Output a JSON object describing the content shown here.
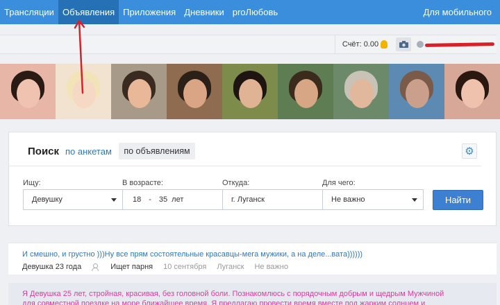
{
  "nav": {
    "items": [
      "Трансляции",
      "Объявления",
      "Приложения",
      "Дневники",
      "proЛюбовь"
    ],
    "active_index": 1,
    "mobile_label": "Для мобильного"
  },
  "user_bar": {
    "score_label": "Счёт: 0.00",
    "camera_icon": "camera-icon",
    "hand_icon": "hand-coin-icon"
  },
  "photos": {
    "count": 9,
    "tones": [
      "#e7b6a6",
      "#f1e3d0",
      "#a89a88",
      "#8f6b4f",
      "#7d8c4a",
      "#5f7d52",
      "#6c8a6a",
      "#5c8ab3",
      "#d7a898"
    ]
  },
  "search": {
    "title": "Поиск",
    "tab_profiles": "по анкетам",
    "tab_ads": "по объявлениям",
    "labels": {
      "looking_for": "Ищу:",
      "age": "В возрасте:",
      "from": "Откуда:",
      "purpose": "Для чего:"
    },
    "looking_for_value": "Девушку",
    "age_from": "18",
    "age_sep": "-",
    "age_to": "35",
    "age_unit": "лет",
    "city_value": "г. Луганск",
    "purpose_value": "Не важно",
    "find_button": "Найти",
    "settings_icon": "gear-icon"
  },
  "results": [
    {
      "headline": "И смешно, и грустно )))Ну все прям состоятельные красавцы-мега мужики, а на деле...вата))))))",
      "who": "Девушка 23 года",
      "seeks": "Ищет парня",
      "date": "10 сентября",
      "city": "Луганск",
      "purpose": "Не важно"
    },
    {
      "text": "Я Девушка 25 лет, стройная, красивая, без головной боли. Познакомлюсь с порядочным добрым и щедрым Мужчиной для совместной поездке на море ближайшее время. Я предлагаю провести время вместе под жарким солнцем и волнами, под луной и"
    }
  ],
  "colors": {
    "nav_bg": "#3a8edb",
    "nav_active": "#2670b6",
    "link": "#2b78c5",
    "accent_button": "#3d7fd0",
    "pink_text": "#e0399b",
    "annotation_red": "#d8202a"
  }
}
